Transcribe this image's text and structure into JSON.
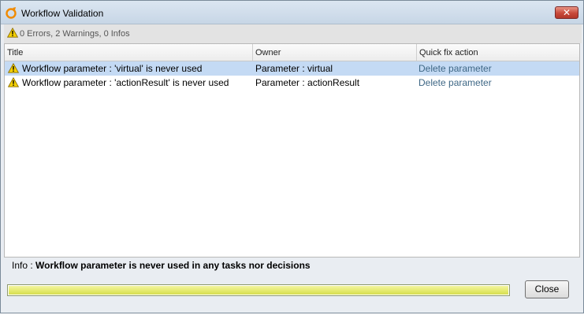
{
  "window": {
    "title": "Workflow Validation",
    "close_glyph": "✕"
  },
  "summary": {
    "text": "0 Errors, 2 Warnings, 0 Infos",
    "icon": "warning-icon"
  },
  "table": {
    "columns": [
      {
        "label": "Title"
      },
      {
        "label": "Owner"
      },
      {
        "label": "Quick fix action"
      }
    ],
    "rows": [
      {
        "icon": "warning-icon",
        "title": "Workflow parameter : 'virtual' is never used",
        "owner": "Parameter : virtual",
        "action": "Delete parameter",
        "selected": true
      },
      {
        "icon": "warning-icon",
        "title": "Workflow parameter : 'actionResult' is never used",
        "owner": "Parameter : actionResult",
        "action": "Delete parameter",
        "selected": false
      }
    ]
  },
  "info": {
    "prefix": "Info : ",
    "message": "Workflow parameter is never used in any tasks nor decisions"
  },
  "progress": {
    "value": 1.0,
    "color": "#e3e96a"
  },
  "buttons": {
    "close_label": "Close"
  },
  "colors": {
    "selected_row": "#c4daf4",
    "link": "#3e6785",
    "close_button_red": "#c8493a"
  }
}
